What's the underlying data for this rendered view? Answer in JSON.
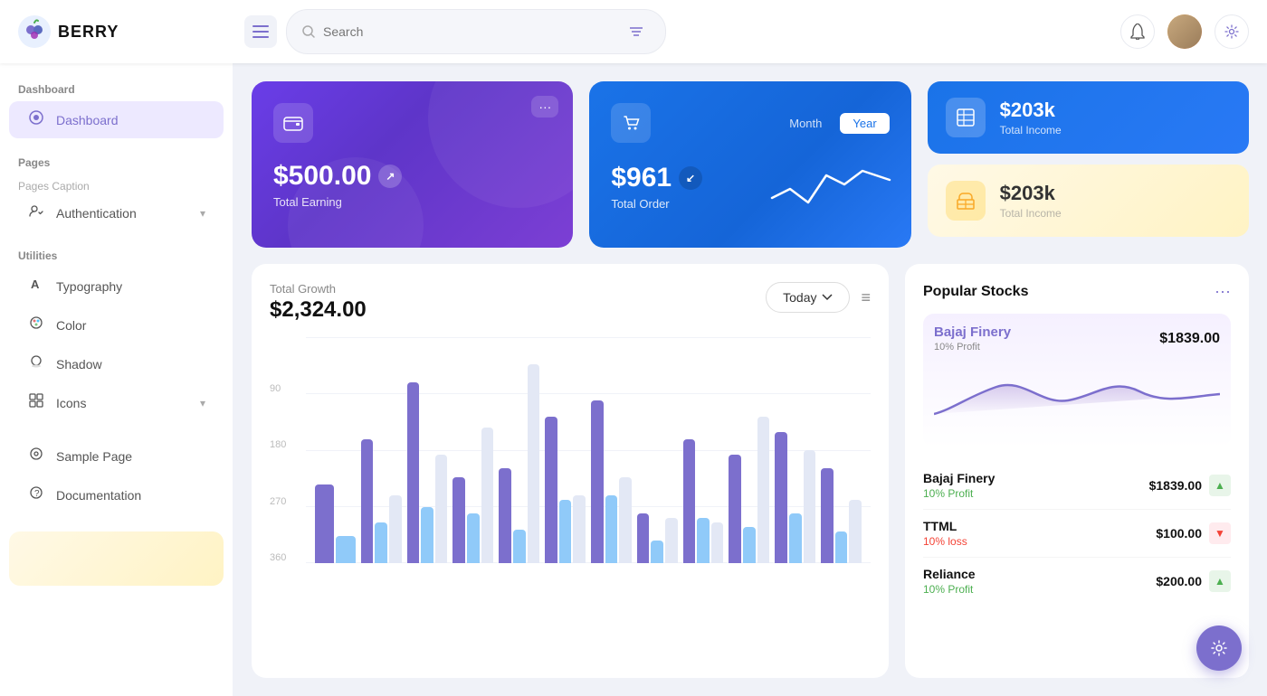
{
  "header": {
    "logo_text": "BERRY",
    "search_placeholder": "Search",
    "hamburger_label": "menu",
    "notif_label": "notifications",
    "gear_label": "settings"
  },
  "sidebar": {
    "section_dashboard": "Dashboard",
    "active_item": "Dashboard",
    "pages_section": "Pages",
    "pages_caption": "Pages Caption",
    "auth_item": "Authentication",
    "utilities_section": "Utilities",
    "typography_item": "Typography",
    "color_item": "Color",
    "shadow_item": "Shadow",
    "icons_item": "Icons",
    "sample_page_item": "Sample Page",
    "documentation_item": "Documentation",
    "dashboard_item": "Dashboard"
  },
  "cards": {
    "earning_amount": "$500.00",
    "earning_label": "Total Earning",
    "order_amount": "$961",
    "order_label": "Total Order",
    "month_tab": "Month",
    "year_tab": "Year",
    "income1_amount": "$203k",
    "income1_label": "Total Income",
    "income2_amount": "$203k",
    "income2_label": "Total Income"
  },
  "chart": {
    "title": "Total Growth",
    "amount": "$2,324.00",
    "button_label": "Today",
    "y_labels": [
      "90",
      "180",
      "270",
      "360"
    ],
    "bars": [
      {
        "purple": 35,
        "blue": 12,
        "light": 0
      },
      {
        "purple": 55,
        "blue": 18,
        "light": 30
      },
      {
        "purple": 80,
        "blue": 25,
        "light": 48
      },
      {
        "purple": 38,
        "blue": 22,
        "light": 60
      },
      {
        "purple": 42,
        "blue": 15,
        "light": 88
      },
      {
        "purple": 65,
        "blue": 28,
        "light": 30
      },
      {
        "purple": 72,
        "blue": 30,
        "light": 38
      },
      {
        "purple": 22,
        "blue": 10,
        "light": 20
      },
      {
        "purple": 55,
        "blue": 20,
        "light": 18
      },
      {
        "purple": 48,
        "blue": 16,
        "light": 65
      },
      {
        "purple": 58,
        "blue": 22,
        "light": 50
      },
      {
        "purple": 42,
        "blue": 14,
        "light": 28
      }
    ]
  },
  "stocks": {
    "title": "Popular Stocks",
    "chart_stock_name": "Bajaj Finery",
    "chart_stock_price": "$1839.00",
    "chart_stock_profit": "10% Profit",
    "rows": [
      {
        "name": "Bajaj Finery",
        "profit_label": "10% Profit",
        "profit_type": "green",
        "price": "$1839.00",
        "trend": "up"
      },
      {
        "name": "TTML",
        "profit_label": "10% loss",
        "profit_type": "red",
        "price": "$100.00",
        "trend": "down"
      },
      {
        "name": "Reliance",
        "profit_label": "10% Profit",
        "profit_type": "green",
        "price": "$200.00",
        "trend": "up"
      }
    ]
  }
}
